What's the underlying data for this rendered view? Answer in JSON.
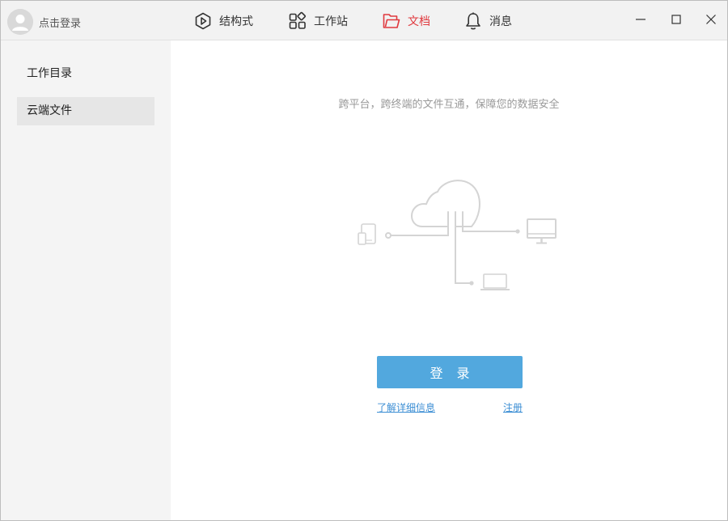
{
  "header": {
    "user_label": "点击登录",
    "nav": [
      {
        "label": "结构式",
        "icon": "hexagon-icon"
      },
      {
        "label": "工作站",
        "icon": "grid-icon"
      },
      {
        "label": "文档",
        "icon": "folder-icon",
        "active": true
      },
      {
        "label": "消息",
        "icon": "bell-icon"
      }
    ],
    "window_controls": [
      "minimize-icon",
      "maximize-icon",
      "close-icon"
    ]
  },
  "sidebar": {
    "items": [
      {
        "label": "工作目录",
        "active": false
      },
      {
        "label": "云端文件",
        "active": true
      }
    ]
  },
  "main": {
    "tagline": "跨平台，跨终端的文件互通，保障您的数据安全",
    "login_label": "登 录",
    "learn_more_label": "了解详细信息",
    "register_label": "注册"
  },
  "colors": {
    "accent_red": "#e0393e",
    "button_blue": "#52a8de",
    "link_blue": "#3b8ed4",
    "sidebar_bg": "#f4f4f4",
    "titlebar_bg": "#f2f2f2"
  }
}
